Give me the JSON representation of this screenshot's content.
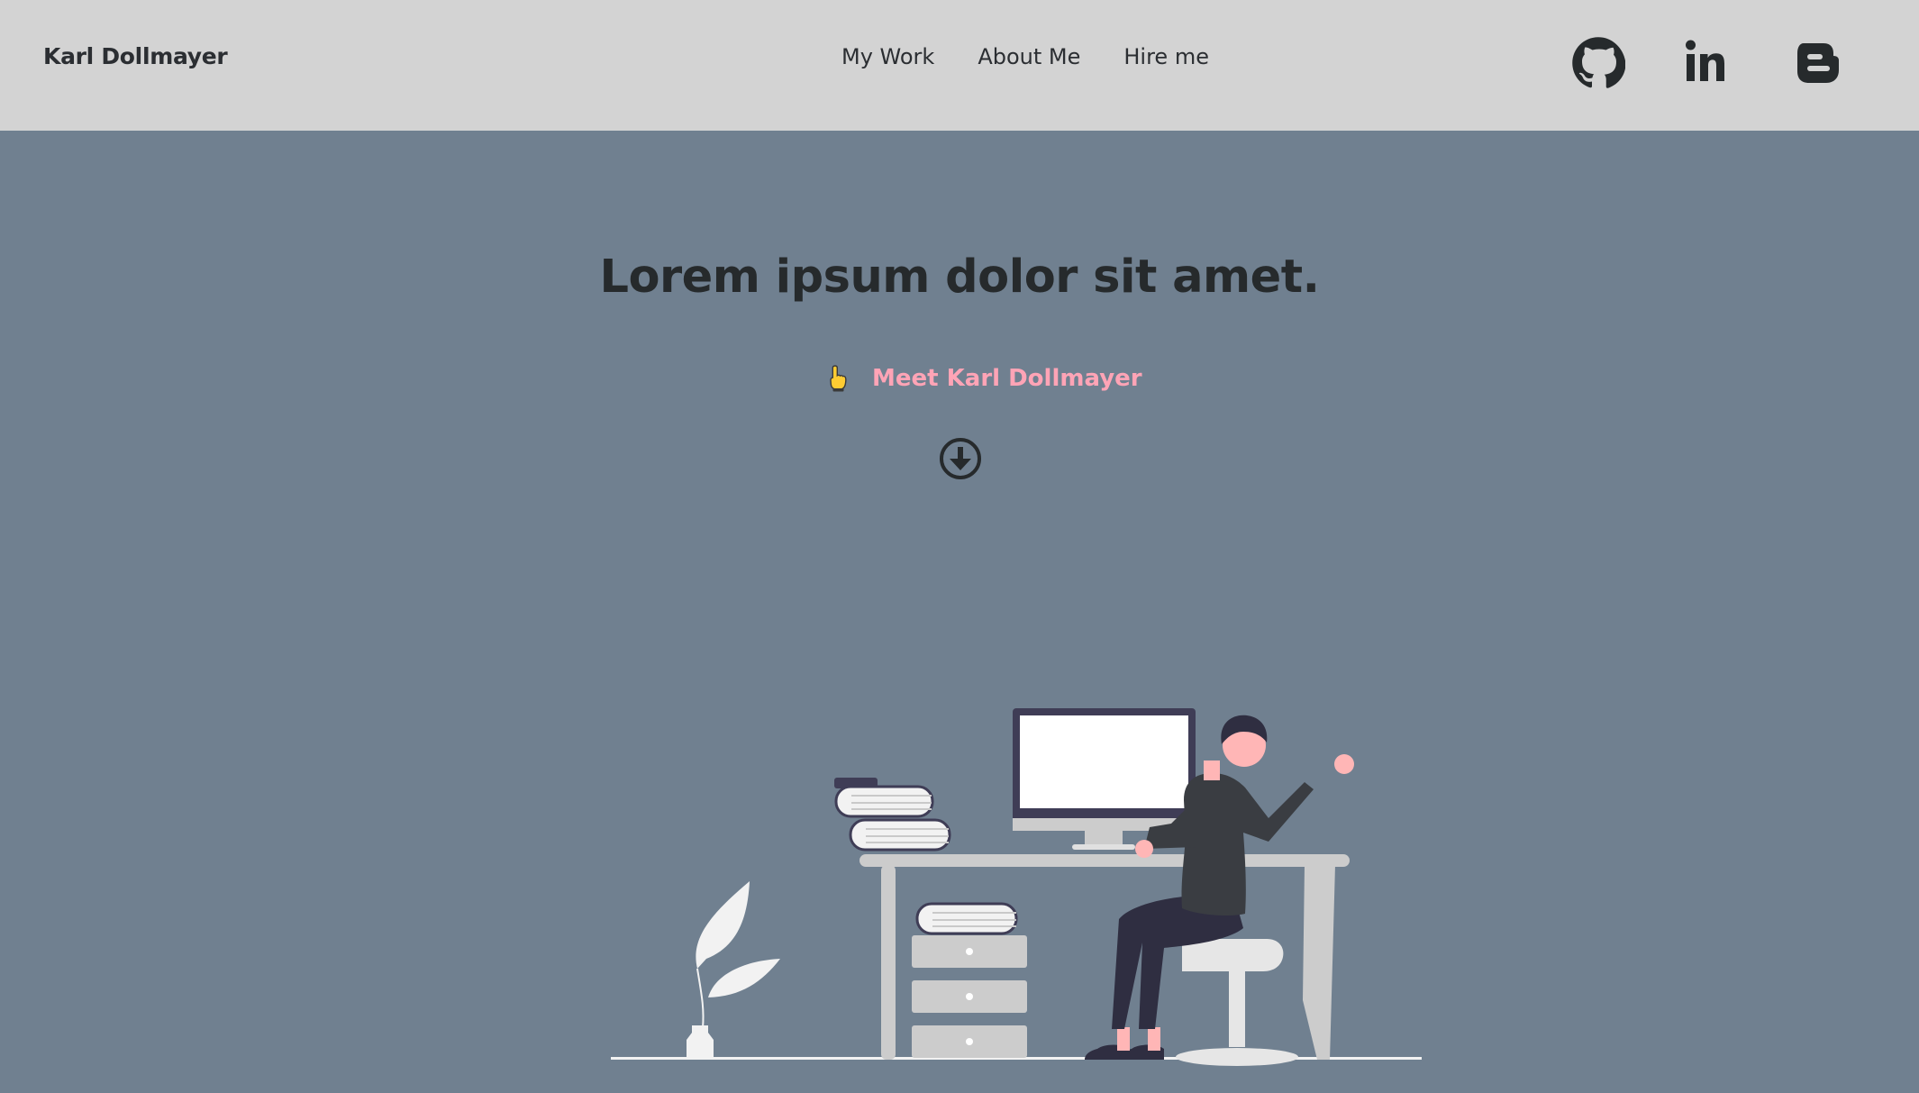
{
  "header": {
    "brand": "Karl Dollmayer",
    "nav": [
      {
        "label": "My Work"
      },
      {
        "label": "About Me"
      },
      {
        "label": "Hire me"
      }
    ],
    "social": [
      {
        "icon": "github-icon"
      },
      {
        "icon": "linkedin-icon"
      },
      {
        "icon": "blogger-icon"
      }
    ]
  },
  "hero": {
    "title": "Lorem ipsum dolor sit amet.",
    "meet_link": "Meet Karl Dollmayer",
    "meet_icon": "pointing-hand-icon",
    "scroll_icon": "arrow-down-circle-icon"
  },
  "illustration": {
    "icon": "person-at-desk-illustration"
  },
  "colors": {
    "header_bg": "#d3d3d3",
    "page_bg": "#708090",
    "text_dark": "#262a2c",
    "accent_pink": "#ffa4b6"
  }
}
